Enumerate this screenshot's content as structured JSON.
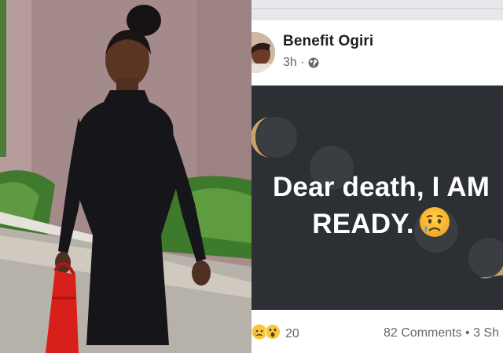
{
  "post": {
    "author": "Benefit Ogiri",
    "time": "3h ·",
    "audience_icon": "globe-icon",
    "text_line1": "Dear death, I AM",
    "text_line2": "READY.",
    "text_emoji": "crying-face-emoji",
    "background_color": "#2c2f33",
    "text_color": "#ffffff"
  },
  "footer": {
    "reaction_icons": [
      "sad-reaction-icon",
      "wow-reaction-icon"
    ],
    "reaction_count": "20",
    "comments_shares": "82 Comments • 3 Sh"
  },
  "photo": {
    "subject": "woman-in-black-dress-with-red-handbag"
  }
}
